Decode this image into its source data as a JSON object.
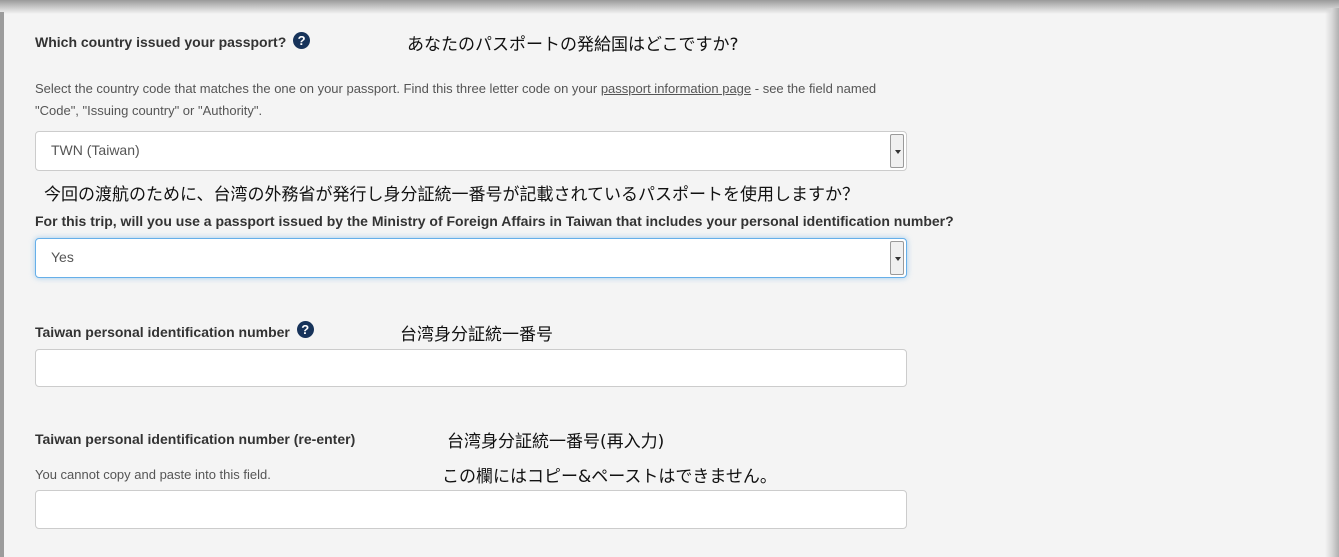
{
  "q1": {
    "label": "Which country issued your passport?",
    "help_icon": "question-circle-icon",
    "help_glyph": "?",
    "jp": "あなたのパスポートの発給国はどこですか?",
    "hint_before": "Select the country code that matches the one on your passport.  Find this three letter code on your ",
    "hint_link": "passport information page",
    "hint_after": " - see the field named",
    "hint_line2": "\"Code\", \"Issuing country\" or \"Authority\".",
    "select_value": "TWN (Taiwan)"
  },
  "q2": {
    "jp": "今回の渡航のために、台湾の外務省が発行し身分証統一番号が記載されているパスポートを使用しますか？",
    "label": "For this trip, will you use a passport issued by the Ministry of Foreign Affairs in Taiwan that includes your personal identification number?",
    "select_value": "Yes"
  },
  "q3": {
    "label": "Taiwan personal identification number",
    "help_glyph": "?",
    "jp": "台湾身分証統一番号",
    "value": ""
  },
  "q4": {
    "label": "Taiwan personal identification number (re-enter)",
    "jp": "台湾身分証統一番号(再入力)",
    "hint": "You cannot copy and paste into this field.",
    "jp_hint": "この欄にはコピー&ペーストはできません。",
    "value": ""
  },
  "colors": {
    "background": "#f4f4f4",
    "help_icon": "#17335a",
    "focus_border": "#66afe9"
  }
}
